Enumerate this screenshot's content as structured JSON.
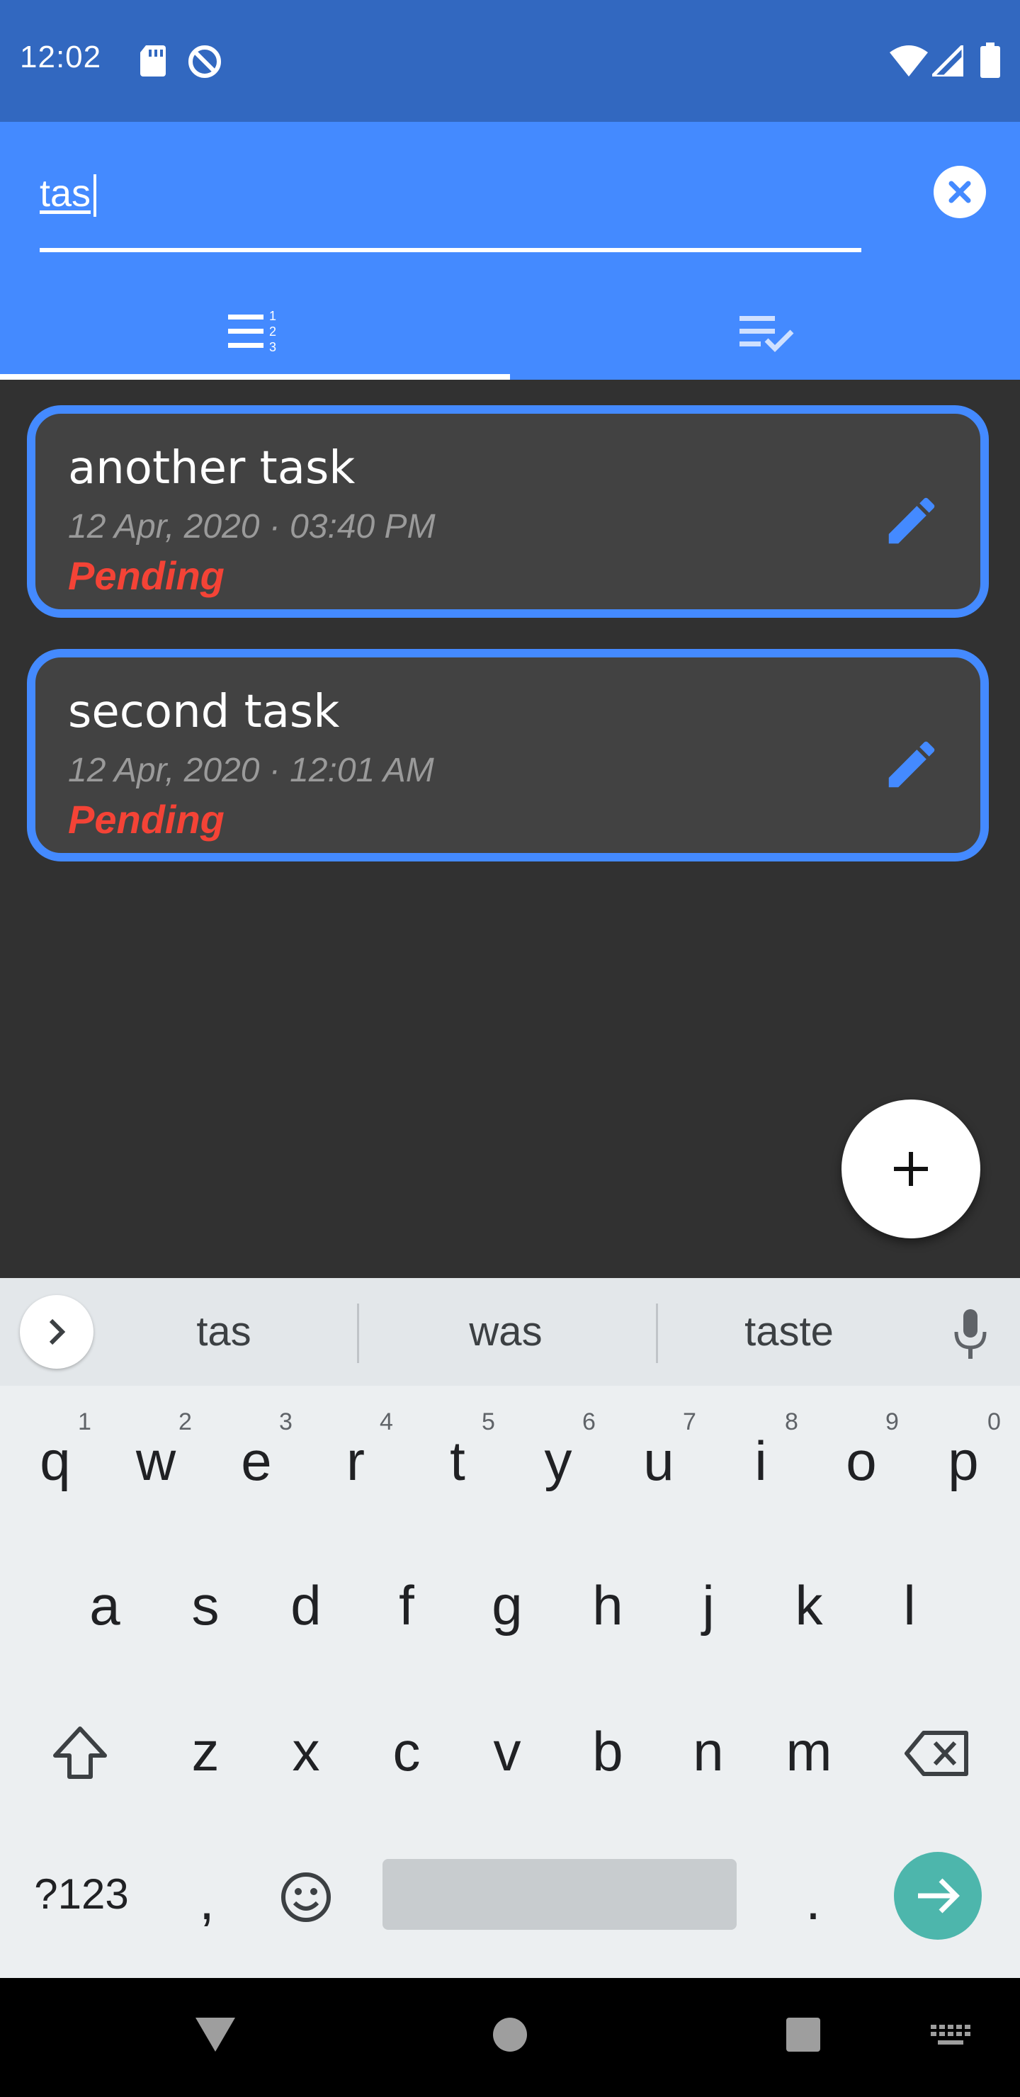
{
  "status_bar": {
    "time": "12:02"
  },
  "search": {
    "value": "tas"
  },
  "tabs": {
    "active": "list",
    "items": [
      "list-numbered-icon",
      "done-list-icon"
    ]
  },
  "tasks": [
    {
      "title": "another task",
      "date": "12 Apr, 2020 · 03:40 PM",
      "status": "Pending"
    },
    {
      "title": "second task",
      "date": "12 Apr, 2020 · 12:01 AM",
      "status": "Pending"
    }
  ],
  "keyboard": {
    "suggestions": [
      "tas",
      "was",
      "taste"
    ],
    "row1": [
      "q",
      "w",
      "e",
      "r",
      "t",
      "y",
      "u",
      "i",
      "o",
      "p"
    ],
    "row1_hints": [
      "1",
      "2",
      "3",
      "4",
      "5",
      "6",
      "7",
      "8",
      "9",
      "0"
    ],
    "row2": [
      "a",
      "s",
      "d",
      "f",
      "g",
      "h",
      "j",
      "k",
      "l"
    ],
    "row3": [
      "z",
      "x",
      "c",
      "v",
      "b",
      "n",
      "m"
    ],
    "row4": {
      "symbols": "?123",
      "comma": ",",
      "period": "."
    }
  },
  "colors": {
    "primary": "#448AFF",
    "status_bar": "#3268C0",
    "pending": "#F44336",
    "card": "#424242",
    "background": "#313131",
    "enter_key": "#4DB6AC"
  }
}
